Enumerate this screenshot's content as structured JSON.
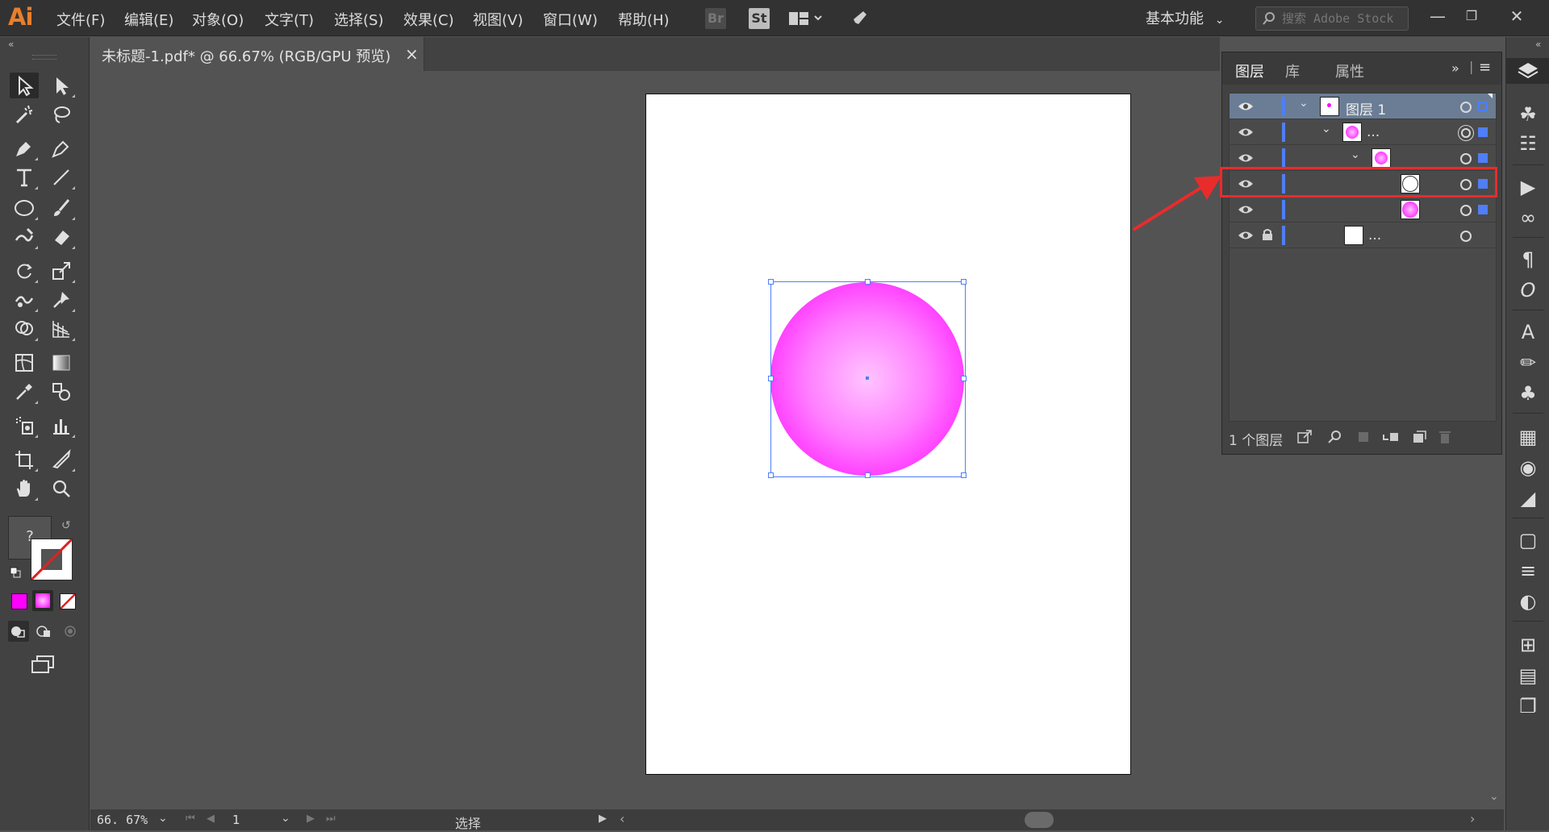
{
  "app": {
    "logo": "Ai",
    "accent": "#e87f2c"
  },
  "menu": [
    "文件(F)",
    "编辑(E)",
    "对象(O)",
    "文字(T)",
    "选择(S)",
    "效果(C)",
    "视图(V)",
    "窗口(W)",
    "帮助(H)"
  ],
  "toolbar_top": {
    "bridge": "Br",
    "stock": "St"
  },
  "workspace": {
    "label": "基本功能"
  },
  "stock_search": {
    "placeholder": "搜索 Adobe Stock"
  },
  "document_tab": {
    "title": "未标题-1.pdf* @ 66.67% (RGB/GPU 预览)",
    "close": "×"
  },
  "layers_panel": {
    "tabs": [
      "图层",
      "库",
      "属性"
    ],
    "active_tab": "图层",
    "rows": [
      {
        "name": "图层 1",
        "level": 0,
        "expanded": true,
        "selected": true,
        "thumb": "layer"
      },
      {
        "name": "...",
        "level": 1,
        "expanded": true,
        "thumb": "gradient-circle"
      },
      {
        "name": "",
        "level": 2,
        "expanded": true,
        "thumb": "gradient-circle"
      },
      {
        "name": "",
        "level": 3,
        "thumb": "white-circle",
        "highlighted": true
      },
      {
        "name": "",
        "level": 3,
        "thumb": "gradient-circle"
      },
      {
        "name": "...",
        "level": 2,
        "thumb": "white-square",
        "locked": true
      }
    ],
    "footer": {
      "count": "1 个图层"
    }
  },
  "colors": {
    "magenta": "#ff00ff",
    "selection_blue": "#4f7ef7",
    "highlight_red": "#e82c2c"
  },
  "status": {
    "zoom": "66. 67%",
    "page": "1",
    "tool": "选择"
  },
  "fill_stroke": {
    "unknown": "?"
  }
}
